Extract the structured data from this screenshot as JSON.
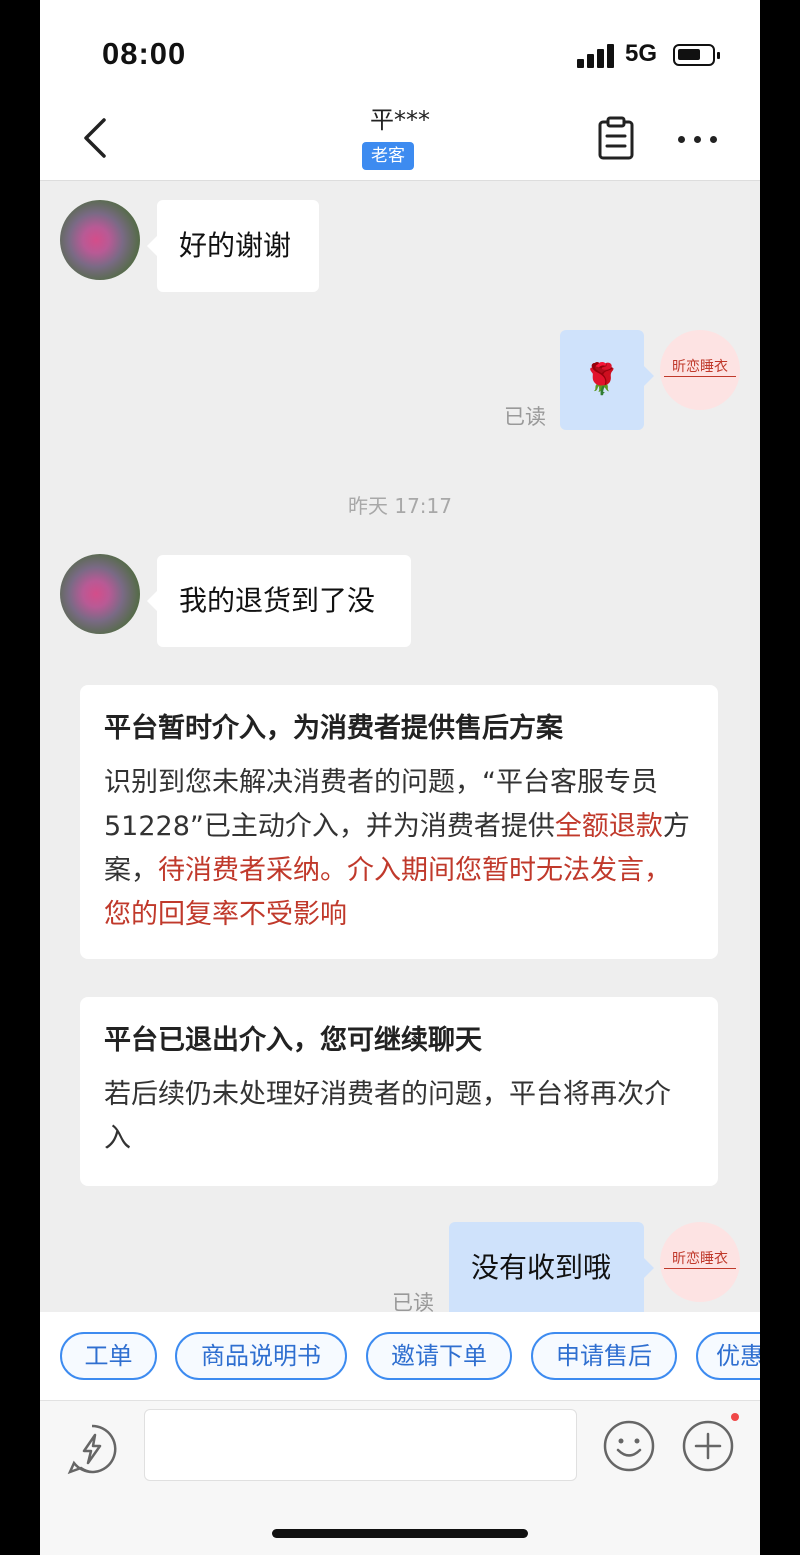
{
  "status_bar": {
    "time": "08:00",
    "network": "5G"
  },
  "nav": {
    "title": "平***",
    "badge": "老客"
  },
  "messages": {
    "m1": "好的谢谢",
    "m2_emoji": "🌹",
    "read_label": "已读",
    "timestamp": "昨天 17:17",
    "m3": "我的退货到了没",
    "m4": "没有收到哦"
  },
  "shop_seal": "昕恋睡衣",
  "card1": {
    "title": "平台暂时介入，为消费者提供售后方案",
    "text_a": "识别到您未解决消费者的问题，“平台客服专员51228”已主动介入，并为消费者提供",
    "text_red1": "全额退款",
    "text_b": "方案，",
    "text_red2": "待消费者采纳。介入期间您暂时无法发言，您的回复率不受影响"
  },
  "card2": {
    "title": "平台已退出介入，您可继续聊天",
    "text": "若后续仍未处理好消费者的问题，平台将再次介入"
  },
  "quick_replies": [
    "工单",
    "商品说明书",
    "邀请下单",
    "申请售后",
    "优惠"
  ],
  "icons": {
    "back": "chevron-left-icon",
    "clipboard": "clipboard-icon",
    "more": "more-icon",
    "bolt": "lightning-icon",
    "emoji": "smiley-icon",
    "plus": "plus-icon"
  },
  "colors": {
    "accent": "#3d8bf0",
    "badge": "#3d8bf0",
    "alert_red": "#c0392b",
    "own_bubble": "#cfe2fb"
  }
}
